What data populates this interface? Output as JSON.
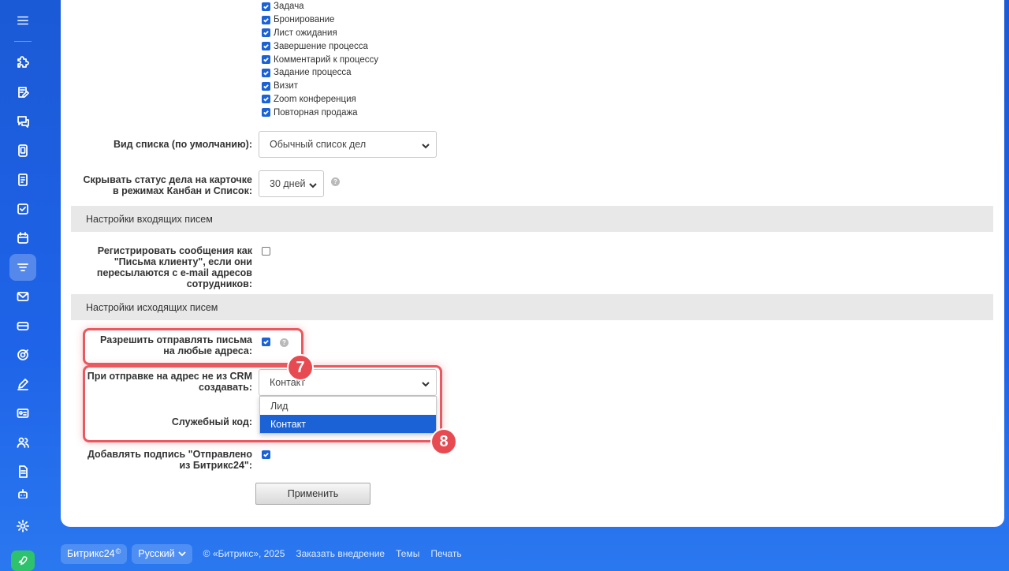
{
  "activity_types": [
    {
      "label": "Задача",
      "checked": true
    },
    {
      "label": "Бронирование",
      "checked": true
    },
    {
      "label": "Лист ожидания",
      "checked": true
    },
    {
      "label": "Завершение процесса",
      "checked": true
    },
    {
      "label": "Комментарий к процессу",
      "checked": true
    },
    {
      "label": "Задание процесса",
      "checked": true
    },
    {
      "label": "Визит",
      "checked": true
    },
    {
      "label": "Zoom конференция",
      "checked": true
    },
    {
      "label": "Повторная продажа",
      "checked": true
    }
  ],
  "list_view": {
    "label": "Вид списка (по умолчанию):",
    "value": "Обычный список дел"
  },
  "hide_status": {
    "label": "Скрывать статус дела на карточке в режимах Канбан и Список:",
    "value": "30 дней",
    "help": "?"
  },
  "incoming": {
    "title": "Настройки входящих писем",
    "register_label": "Регистрировать сообщения как \"Письма клиенту\", если они пересылаются с e-mail адресов сотрудников:",
    "register_checked": false
  },
  "outgoing": {
    "title": "Настройки исходящих писем",
    "allow_label": "Разрешить отправлять письма на любые адреса:",
    "allow_checked": true,
    "allow_help": "?",
    "create_label": "При отправке на адрес не из CRM создавать:",
    "create_value": "Контакт",
    "create_options": [
      "Лид",
      "Контакт"
    ],
    "service_code_label": "Служебный код:",
    "signature_label": "Добавлять подпись \"Отправлено из Битрикс24\":",
    "signature_checked": true
  },
  "badges": [
    "7",
    "8"
  ],
  "apply_label": "Применить",
  "footer": {
    "brand": "Битрикс24",
    "brand_mark": "©",
    "language": "Русский",
    "copyright": "© «Битрикс», 2025",
    "links": [
      "Заказать внедрение",
      "Темы",
      "Печать"
    ]
  },
  "colors": {
    "accent": "#1a62d6",
    "highlight": "#e9595f",
    "badge": "#e74b51",
    "rocket": "#2fc26d"
  }
}
